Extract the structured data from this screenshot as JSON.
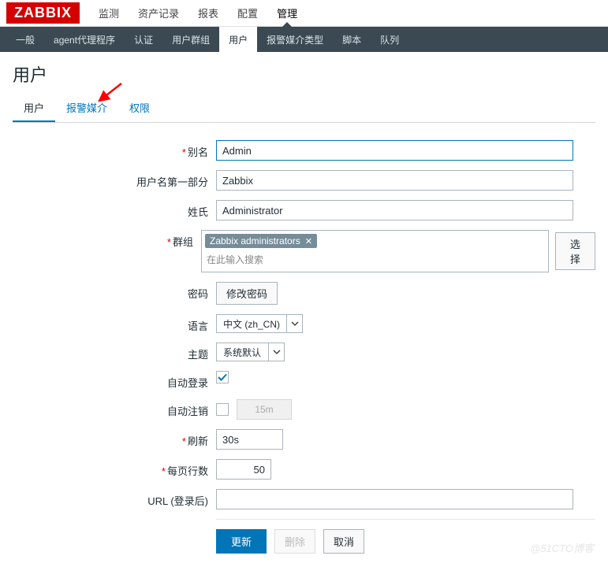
{
  "logo": "ZABBIX",
  "top_menu": [
    {
      "label": "监测"
    },
    {
      "label": "资产记录"
    },
    {
      "label": "报表"
    },
    {
      "label": "配置"
    },
    {
      "label": "管理",
      "active": true
    }
  ],
  "sub_menu": [
    {
      "label": "一般"
    },
    {
      "label": "agent代理程序"
    },
    {
      "label": "认证"
    },
    {
      "label": "用户群组"
    },
    {
      "label": "用户",
      "active": true
    },
    {
      "label": "报警媒介类型"
    },
    {
      "label": "脚本"
    },
    {
      "label": "队列"
    }
  ],
  "page_title": "用户",
  "tabs": [
    {
      "label": "用户",
      "active": true
    },
    {
      "label": "报警媒介"
    },
    {
      "label": "权限"
    }
  ],
  "form": {
    "alias": {
      "label": "别名",
      "required": true,
      "value": "Admin"
    },
    "name": {
      "label": "用户名第一部分",
      "value": "Zabbix"
    },
    "surname": {
      "label": "姓氏",
      "value": "Administrator"
    },
    "groups": {
      "label": "群组",
      "required": true,
      "tag": "Zabbix administrators",
      "placeholder": "在此输入搜索",
      "select_btn": "选择"
    },
    "password": {
      "label": "密码",
      "btn": "修改密码"
    },
    "language": {
      "label": "语言",
      "value": "中文 (zh_CN)"
    },
    "theme": {
      "label": "主题",
      "value": "系统默认"
    },
    "auto_login": {
      "label": "自动登录",
      "checked": true
    },
    "auto_logout": {
      "label": "自动注销",
      "checked": false,
      "value": "15m"
    },
    "refresh": {
      "label": "刷新",
      "required": true,
      "value": "30s"
    },
    "rows": {
      "label": "每页行数",
      "required": true,
      "value": "50"
    },
    "url": {
      "label": "URL (登录后)",
      "value": ""
    }
  },
  "buttons": {
    "update": "更新",
    "delete": "删除",
    "cancel": "取消"
  },
  "watermark": "@51CTO博客"
}
